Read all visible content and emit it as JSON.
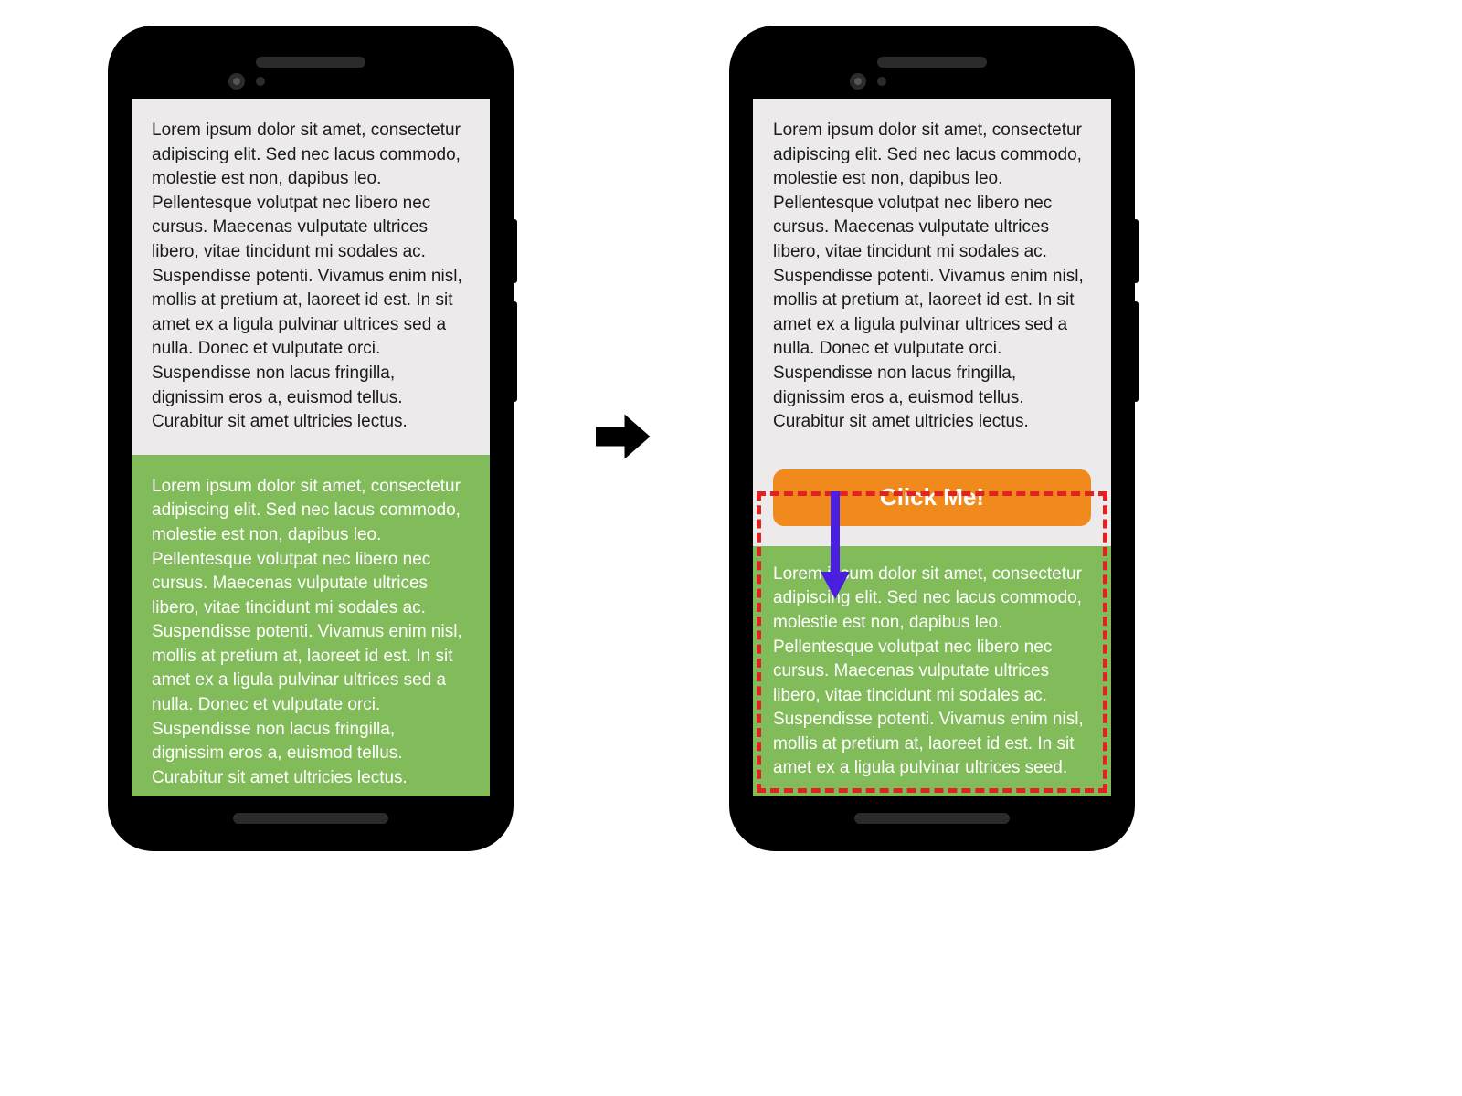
{
  "paragraphs": {
    "lorem_full": "Lorem ipsum dolor sit amet, consectetur adipiscing elit. Sed nec lacus commodo, molestie est non, dapibus leo. Pellentesque volutpat nec libero nec cursus. Maecenas vulputate ultrices libero, vitae tincidunt mi sodales ac. Suspendisse potenti. Vivamus enim nisl, mollis at pretium at, laoreet id est. In sit amet ex a ligula pulvinar ultrices sed a nulla. Donec et vulputate orci. Suspendisse non lacus fringilla, dignissim eros a, euismod tellus. Curabitur sit amet ultricies lectus.",
    "lorem_cut": "Lorem ipsum dolor sit amet, consectetur adipiscing elit. Sed nec lacus commodo, molestie est non, dapibus leo. Pellentesque volutpat nec libero nec cursus. Maecenas vulputate ultrices libero, vitae tincidunt mi sodales ac. Suspendisse potenti. Vivamus enim nisl, mollis at pretium at, laoreet id est. In sit amet ex a ligula pulvinar ultrices seed."
  },
  "button": {
    "label": "Click Me!"
  },
  "colors": {
    "green": "#82bb5a",
    "orange": "#f08a1d",
    "dash_red": "#e12222",
    "arrow_purple": "#4a1fe0",
    "screen_bg": "#eceaea"
  },
  "annotations": {
    "transition_arrow": "right-arrow",
    "shift_arrow": "down-arrow",
    "highlight": "dashed-red-rectangle"
  }
}
